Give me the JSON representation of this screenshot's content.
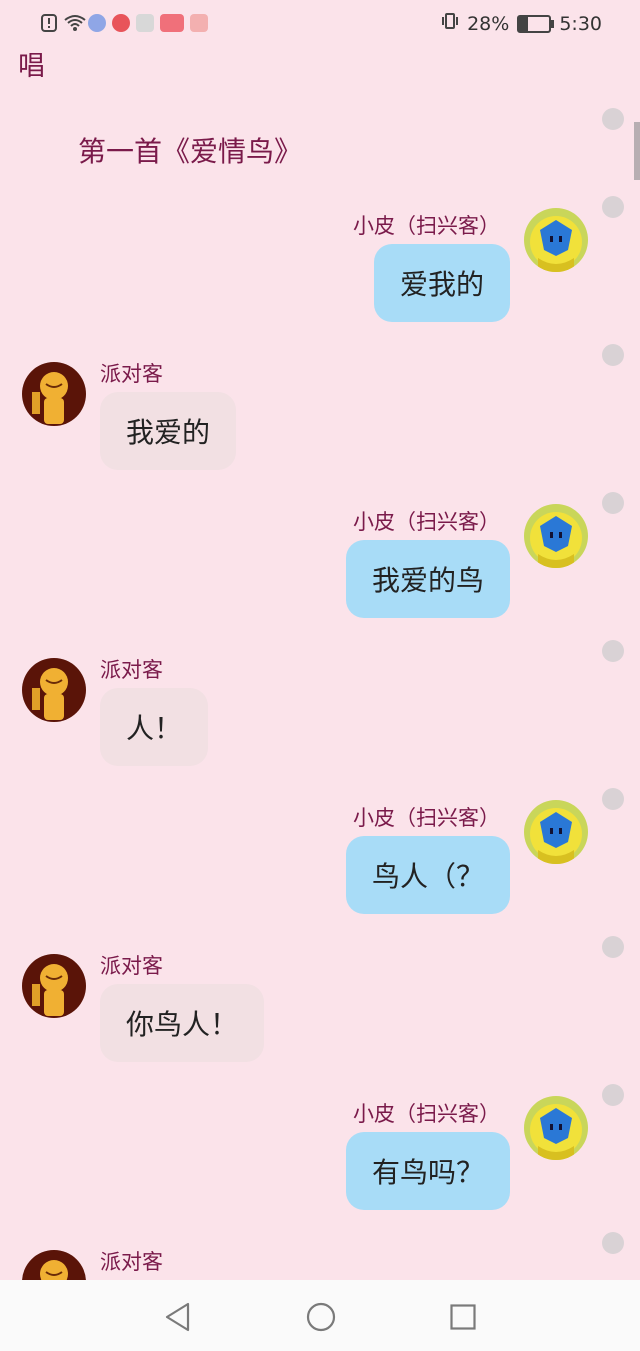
{
  "status_bar": {
    "battery_percent": "28%",
    "battery_level": 0.28,
    "time": "5:30",
    "icons": [
      "alert-icon",
      "wifi-icon",
      "music-icon",
      "app-icon",
      "keyboard-icon",
      "app-icon",
      "app-icon"
    ]
  },
  "page": {
    "title": "唱"
  },
  "chat": {
    "song_title": "第一首《爱情鸟》",
    "messages": [
      {
        "side": "right",
        "name": "小皮（扫兴客）",
        "text": "爱我的"
      },
      {
        "side": "left",
        "name": "派对客",
        "text": "我爱的"
      },
      {
        "side": "right",
        "name": "小皮（扫兴客）",
        "text": "我爱的鸟"
      },
      {
        "side": "left",
        "name": "派对客",
        "text": "人！"
      },
      {
        "side": "right",
        "name": "小皮（扫兴客）",
        "text": "鸟人（？"
      },
      {
        "side": "left",
        "name": "派对客",
        "text": "你鸟人！"
      },
      {
        "side": "right",
        "name": "小皮（扫兴客）",
        "text": "有鸟吗？"
      },
      {
        "side": "left",
        "name": "派对客",
        "text": ""
      }
    ]
  },
  "colors": {
    "background": "#fbe3ea",
    "accent_text": "#7a1a4a",
    "right_bubble": "#a8dcf7",
    "left_bubble": "#f2e0e3"
  },
  "nav_bar": {
    "icons": [
      "back-icon",
      "home-icon",
      "recent-apps-icon"
    ]
  }
}
